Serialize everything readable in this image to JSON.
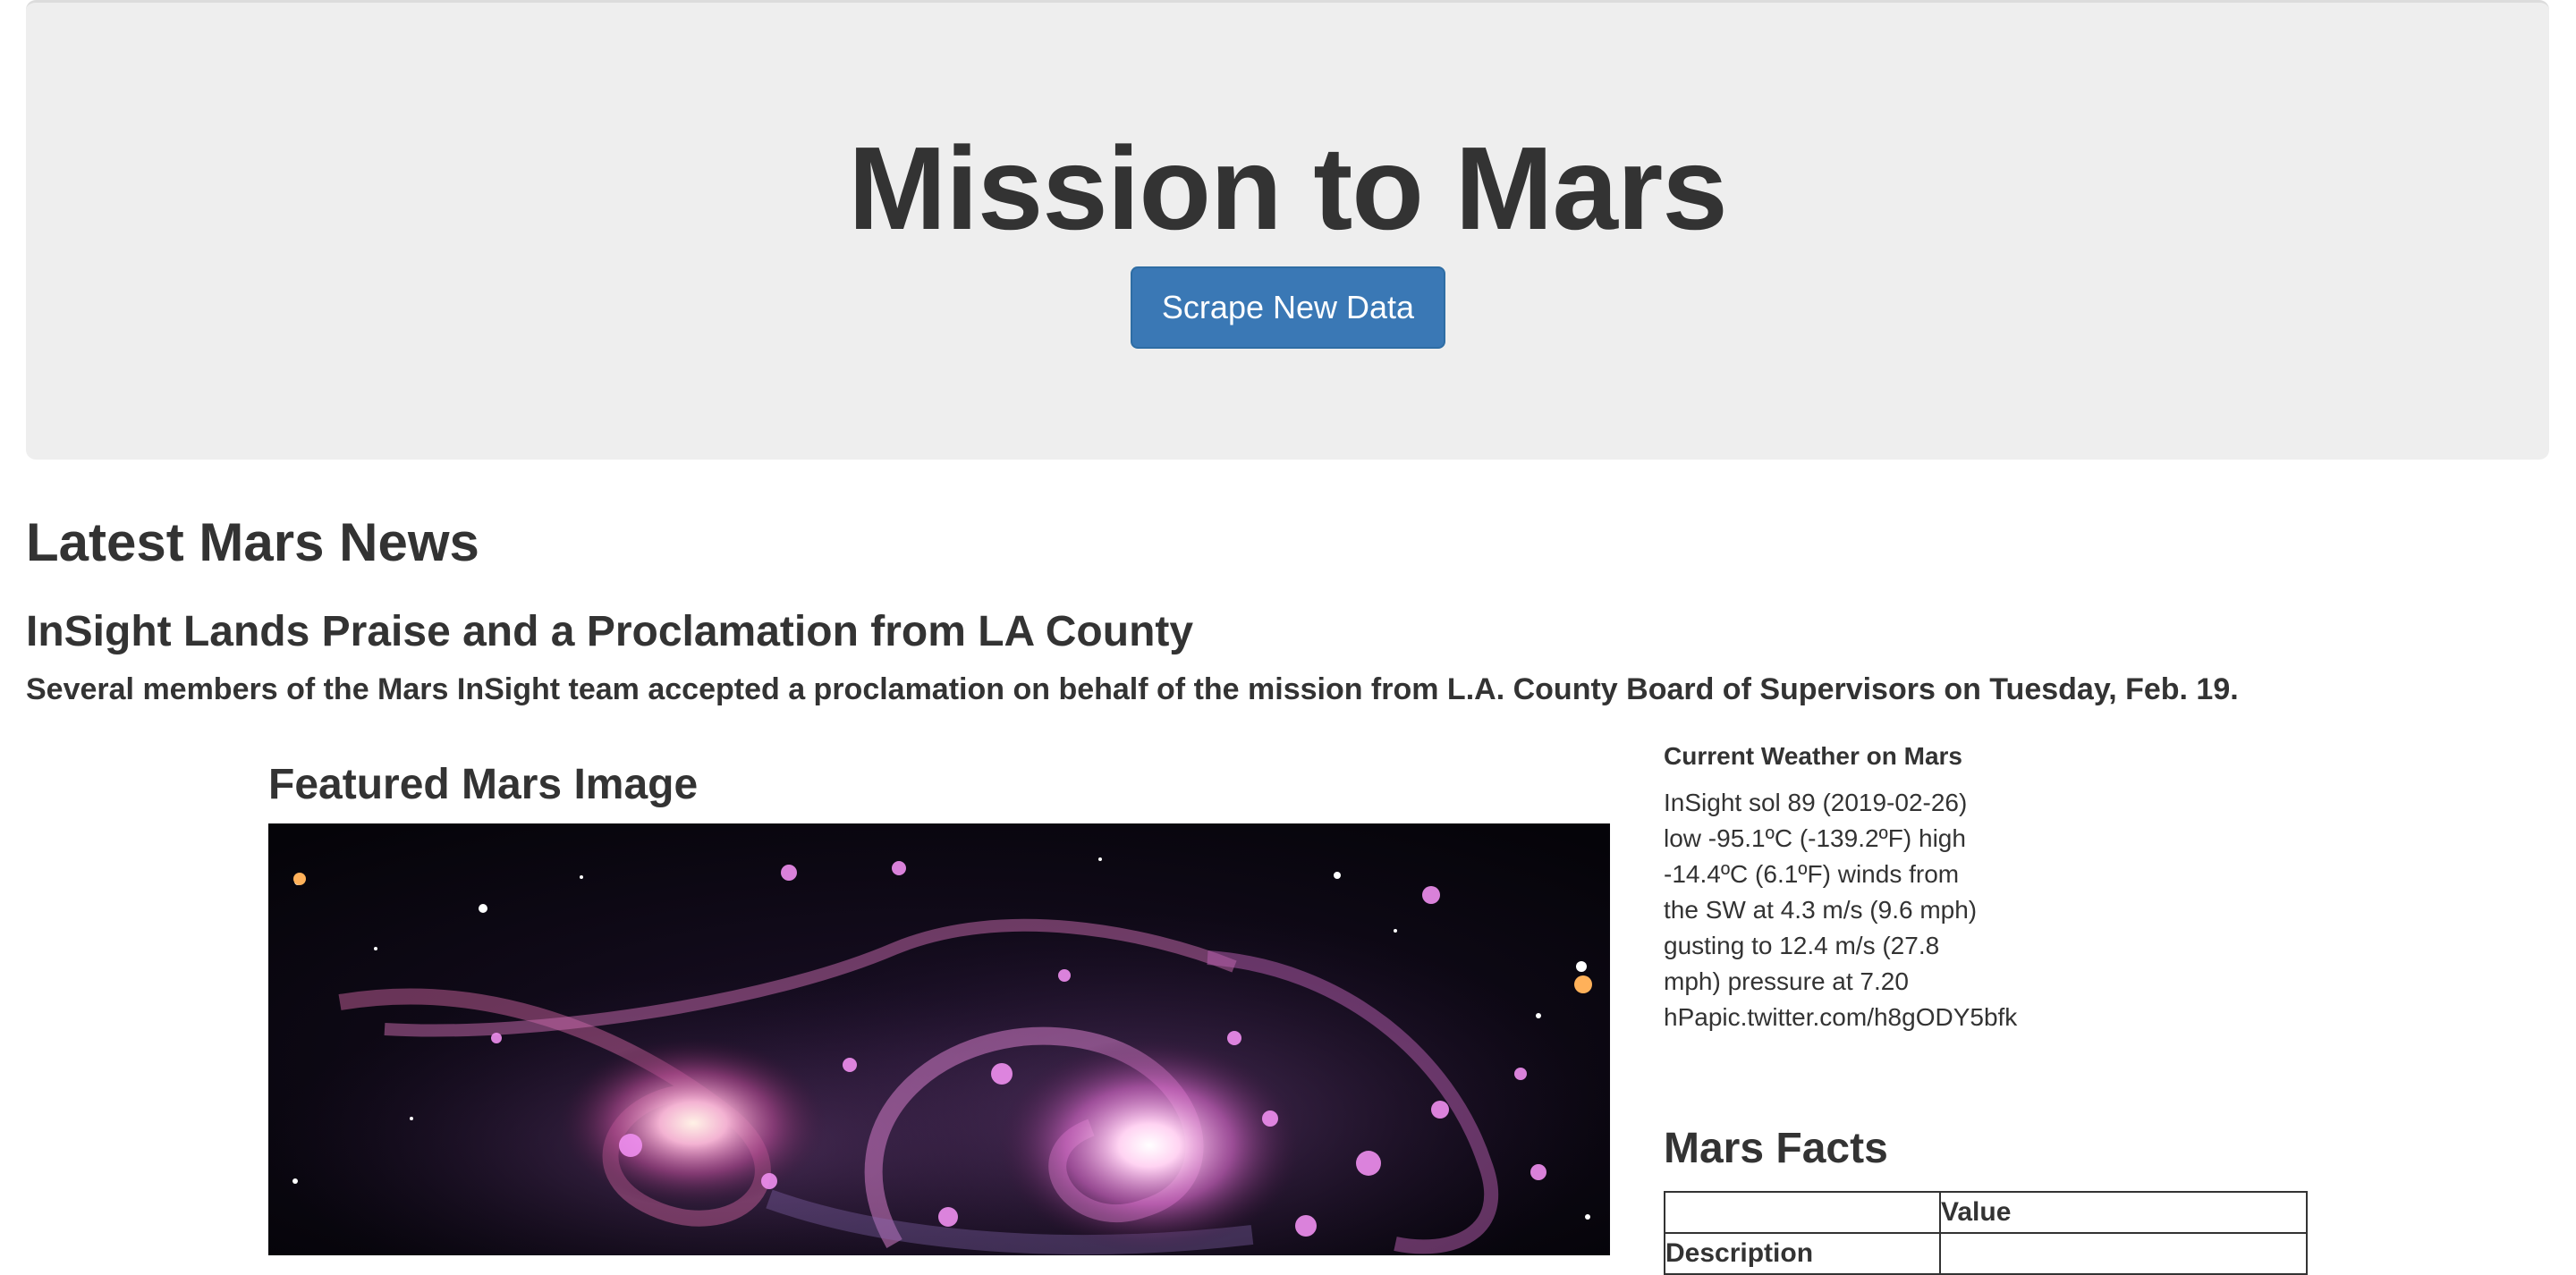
{
  "header": {
    "title": "Mission to Mars",
    "scrape_button_label": "Scrape New Data"
  },
  "news": {
    "section_heading": "Latest Mars News",
    "title": "InSight Lands Praise and a Proclamation from LA County",
    "paragraph": "Several members of the Mars InSight team accepted a proclamation on behalf of the mission from L.A. County Board of Supervisors on Tuesday, Feb. 19."
  },
  "featured_image": {
    "heading": "Featured Mars Image",
    "subject": "interacting spiral galaxies"
  },
  "weather": {
    "heading": "Current Weather on Mars",
    "lines": [
      "InSight sol 89 (2019-02-26)",
      "low -95.1ºC (-139.2ºF) high",
      "-14.4ºC (6.1ºF) winds from",
      "the SW at 4.3 m/s (9.6 mph)",
      "gusting to 12.4 m/s (27.8",
      "mph) pressure at 7.20",
      "hPapic.twitter.com/h8gODY5bfk"
    ]
  },
  "facts": {
    "heading": "Mars Facts",
    "columns": [
      "",
      "Value"
    ],
    "rows": [
      {
        "label": "Description",
        "value": ""
      }
    ]
  },
  "colors": {
    "jumbotron_bg": "#eeeeee",
    "button_primary": "#3a78b5",
    "text": "#333333"
  }
}
